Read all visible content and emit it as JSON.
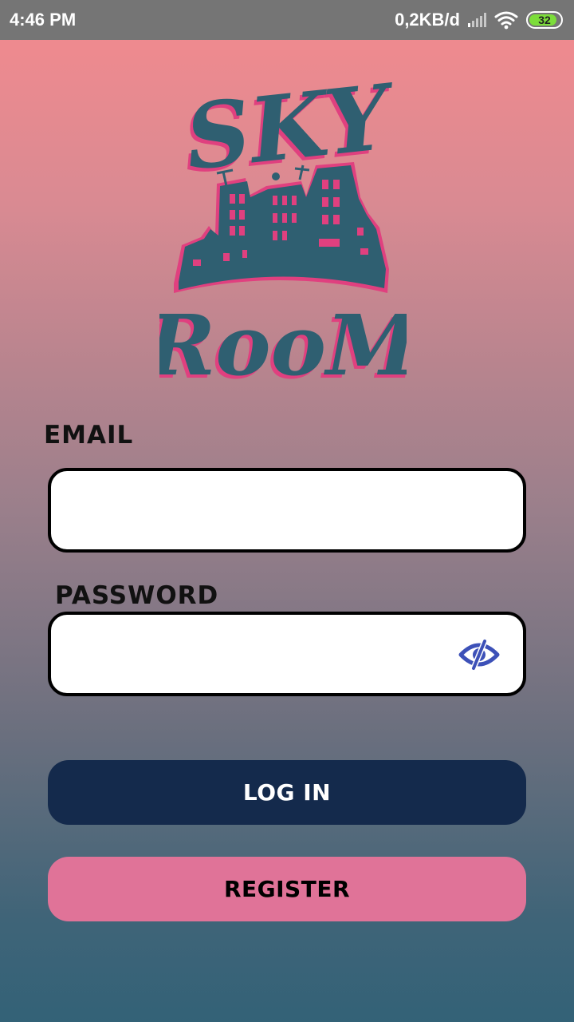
{
  "status_bar": {
    "time": "4:46 PM",
    "network_speed": "0,2KB/d",
    "battery": "32"
  },
  "logo": {
    "line1": "SKY",
    "line2": "RooM",
    "colors": {
      "primary": "#2f5f71",
      "accent": "#e0407f"
    }
  },
  "form": {
    "email_label": "EMAIL",
    "email_value": "",
    "password_label": "PASSWORD",
    "password_value": "",
    "toggle_icon": "eye-slash-icon"
  },
  "buttons": {
    "login_label": "LOG IN",
    "register_label": "REGISTER"
  },
  "colors": {
    "login_bg": "#142a4c",
    "register_bg": "#e07398",
    "eye_icon": "#3d51b8"
  }
}
